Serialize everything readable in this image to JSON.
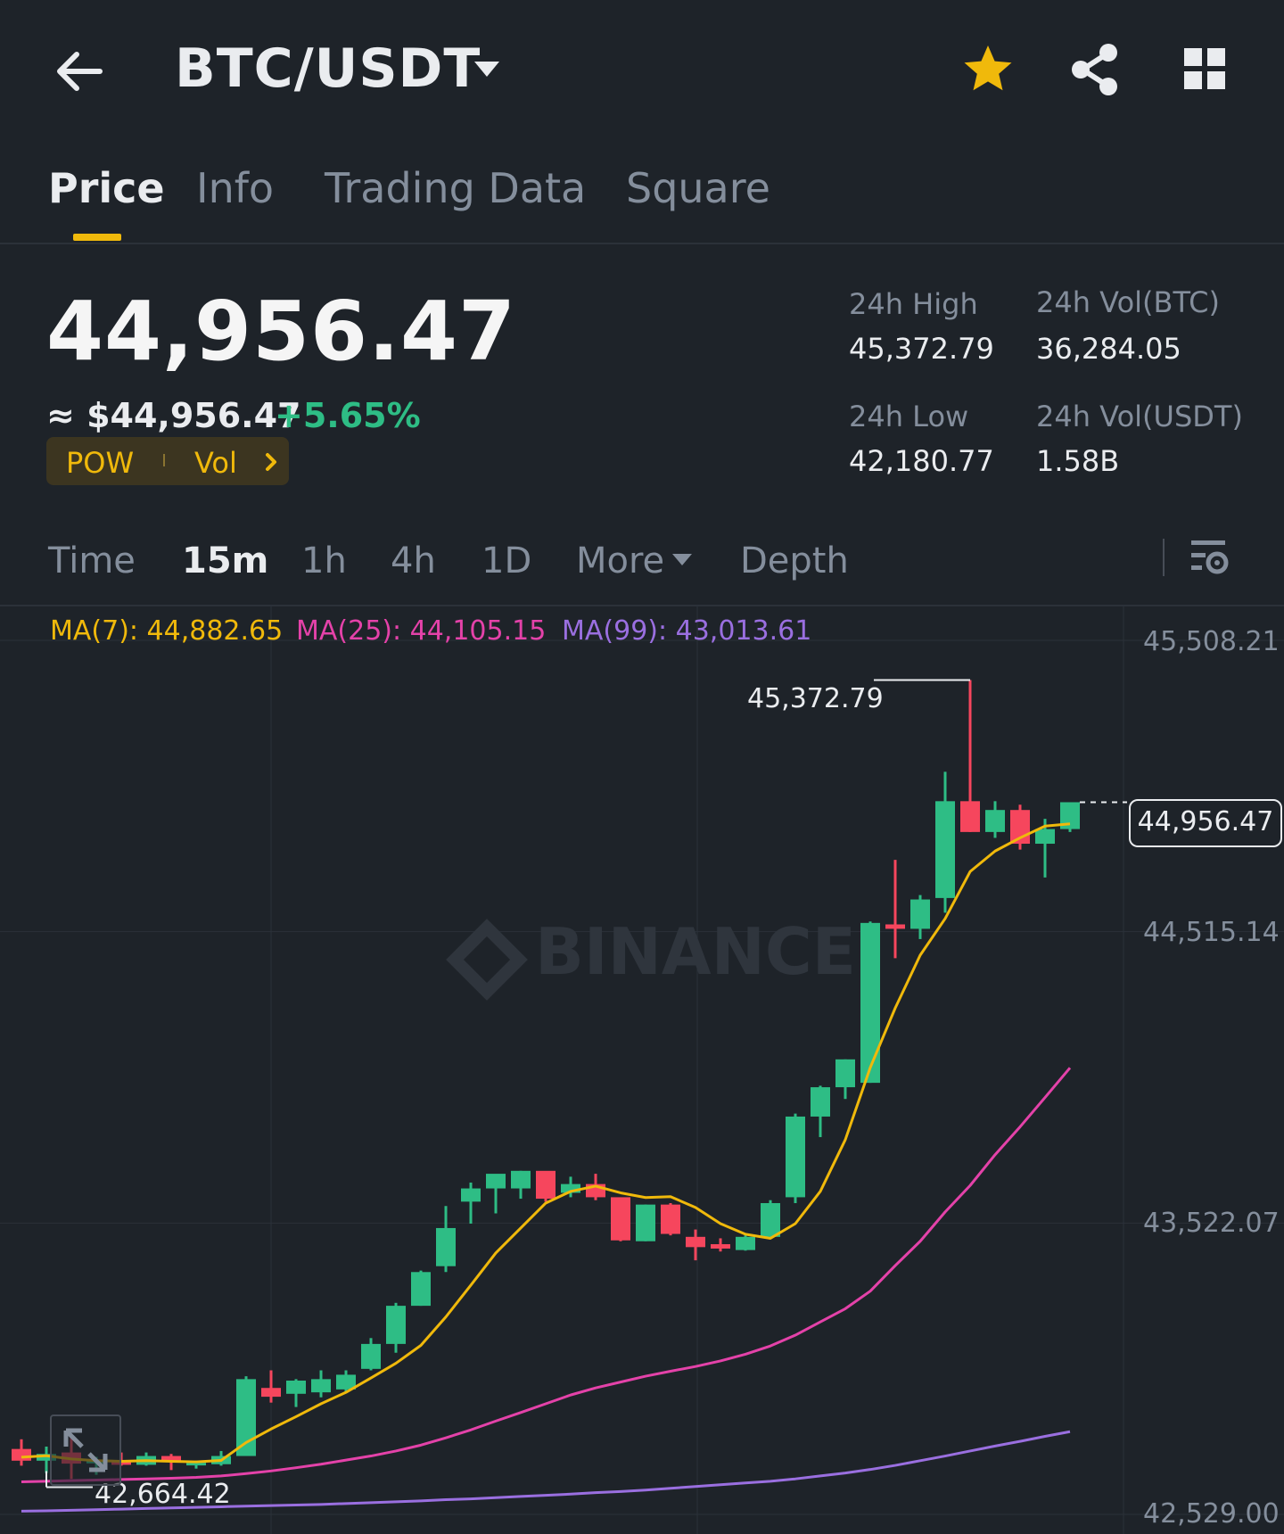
{
  "header": {
    "pair": "BTC/USDT"
  },
  "tabs": [
    {
      "label": "Price"
    },
    {
      "label": "Info"
    },
    {
      "label": "Trading Data"
    },
    {
      "label": "Square"
    }
  ],
  "ticker": {
    "last_price": "44,956.47",
    "fiat_price": "≈ $44,956.47",
    "change_pct": "+5.65%",
    "tag_pow": "POW",
    "tag_vol": "Vol",
    "stats": {
      "high_label": "24h High",
      "high_value": "45,372.79",
      "low_label": "24h Low",
      "low_value": "42,180.77",
      "vol_btc_label": "24h Vol(BTC)",
      "vol_btc_value": "36,284.05",
      "vol_usdt_label": "24h Vol(USDT)",
      "vol_usdt_value": "1.58B"
    }
  },
  "timeframes": [
    {
      "label": "Time"
    },
    {
      "label": "15m"
    },
    {
      "label": "1h"
    },
    {
      "label": "4h"
    },
    {
      "label": "1D"
    },
    {
      "label": "More"
    },
    {
      "label": "Depth"
    }
  ],
  "indicators": {
    "ma7": "MA(7): 44,882.65",
    "ma25": "MA(25): 44,105.15",
    "ma99": "MA(99): 43,013.61"
  },
  "colors": {
    "up": "#2ebd85",
    "down": "#f6465d",
    "accent": "#f0b90b",
    "ma7": "#f0b90b",
    "ma25": "#e442a9",
    "ma99": "#9a6fe0"
  },
  "chart_data": {
    "type": "candlestick",
    "symbol": "BTC/USDT",
    "interval": "15m",
    "y_ticks": [
      "45,508.21",
      "44,515.14",
      "43,522.07",
      "42,529.00"
    ],
    "ylim": [
      42529.0,
      45508.21
    ],
    "last_price_label": "44,956.47",
    "high_marker_label": "45,372.79",
    "low_marker_label": "42,664.42",
    "watermark": "BINANCE",
    "candles": [
      {
        "o": 42752,
        "h": 42785,
        "l": 42695,
        "c": 42712
      },
      {
        "o": 42712,
        "h": 42760,
        "l": 42670,
        "c": 42735
      },
      {
        "o": 42740,
        "h": 42790,
        "l": 42650,
        "c": 42702
      },
      {
        "o": 42705,
        "h": 42725,
        "l": 42664,
        "c": 42712
      },
      {
        "o": 42712,
        "h": 42740,
        "l": 42695,
        "c": 42698
      },
      {
        "o": 42698,
        "h": 42740,
        "l": 42695,
        "c": 42728
      },
      {
        "o": 42728,
        "h": 42735,
        "l": 42680,
        "c": 42708
      },
      {
        "o": 42700,
        "h": 42712,
        "l": 42685,
        "c": 42705
      },
      {
        "o": 42700,
        "h": 42745,
        "l": 42695,
        "c": 42728
      },
      {
        "o": 42728,
        "h": 43000,
        "l": 42728,
        "c": 42990
      },
      {
        "o": 42960,
        "h": 43020,
        "l": 42910,
        "c": 42930
      },
      {
        "o": 42940,
        "h": 42990,
        "l": 42895,
        "c": 42985
      },
      {
        "o": 42945,
        "h": 43020,
        "l": 42928,
        "c": 42990
      },
      {
        "o": 42955,
        "h": 43020,
        "l": 42945,
        "c": 43005
      },
      {
        "o": 43025,
        "h": 43130,
        "l": 43020,
        "c": 43110
      },
      {
        "o": 43110,
        "h": 43250,
        "l": 43080,
        "c": 43240
      },
      {
        "o": 43240,
        "h": 43360,
        "l": 43240,
        "c": 43355
      },
      {
        "o": 43375,
        "h": 43580,
        "l": 43355,
        "c": 43505
      },
      {
        "o": 43595,
        "h": 43660,
        "l": 43520,
        "c": 43640
      },
      {
        "o": 43640,
        "h": 43670,
        "l": 43555,
        "c": 43690
      },
      {
        "o": 43640,
        "h": 43700,
        "l": 43605,
        "c": 43700
      },
      {
        "o": 43700,
        "h": 43690,
        "l": 43595,
        "c": 43605
      },
      {
        "o": 43625,
        "h": 43680,
        "l": 43610,
        "c": 43655
      },
      {
        "o": 43655,
        "h": 43690,
        "l": 43600,
        "c": 43610
      },
      {
        "o": 43610,
        "h": 43600,
        "l": 43460,
        "c": 43463
      },
      {
        "o": 43460,
        "h": 43585,
        "l": 43460,
        "c": 43585
      },
      {
        "o": 43585,
        "h": 43590,
        "l": 43480,
        "c": 43485
      },
      {
        "o": 43475,
        "h": 43500,
        "l": 43395,
        "c": 43440
      },
      {
        "o": 43450,
        "h": 43470,
        "l": 43425,
        "c": 43435
      },
      {
        "o": 43430,
        "h": 43480,
        "l": 43428,
        "c": 43475
      },
      {
        "o": 43475,
        "h": 43600,
        "l": 43470,
        "c": 43590
      },
      {
        "o": 43610,
        "h": 43895,
        "l": 43590,
        "c": 43885
      },
      {
        "o": 43885,
        "h": 43990,
        "l": 43815,
        "c": 43985
      },
      {
        "o": 43985,
        "h": 44080,
        "l": 43945,
        "c": 44080
      },
      {
        "o": 44000,
        "h": 44550,
        "l": 44000,
        "c": 44545
      },
      {
        "o": 44540,
        "h": 44760,
        "l": 44425,
        "c": 44525
      },
      {
        "o": 44525,
        "h": 44640,
        "l": 44490,
        "c": 44625
      },
      {
        "o": 44630,
        "h": 45060,
        "l": 44580,
        "c": 44960
      },
      {
        "o": 44960,
        "h": 45372.79,
        "l": 44855,
        "c": 44855
      },
      {
        "o": 44855,
        "h": 44960,
        "l": 44835,
        "c": 44930
      },
      {
        "o": 44930,
        "h": 44948,
        "l": 44795,
        "c": 44815
      },
      {
        "o": 44815,
        "h": 44900,
        "l": 44700,
        "c": 44865
      },
      {
        "o": 44865,
        "h": 44956.47,
        "l": 44855,
        "c": 44956.47
      }
    ],
    "ma7": [
      42724,
      42729,
      42718,
      42712,
      42710,
      42712,
      42710,
      42708,
      42713,
      42774,
      42820,
      42862,
      42906,
      42945,
      42994,
      43044,
      43105,
      43202,
      43310,
      43420,
      43505,
      43590,
      43630,
      43648,
      43625,
      43609,
      43612,
      43575,
      43520,
      43484,
      43470,
      43520,
      43630,
      43806,
      44052,
      44255,
      44435,
      44560,
      44720,
      44790,
      44835,
      44875,
      44882.65
    ],
    "ma25": [
      42640,
      42642,
      42644,
      42646,
      42648,
      42650,
      42652,
      42655,
      42660,
      42668,
      42677,
      42688,
      42700,
      42714,
      42728,
      42745,
      42765,
      42790,
      42817,
      42847,
      42876,
      42906,
      42936,
      42960,
      42980,
      43000,
      43017,
      43033,
      43052,
      43075,
      43103,
      43140,
      43185,
      43230,
      43290,
      43377,
      43460,
      43560,
      43650,
      43755,
      43850,
      43950,
      44051
    ],
    "ma99": [
      42540,
      42541,
      42543,
      42545,
      42547,
      42549,
      42551,
      42553,
      42555,
      42557,
      42559,
      42561,
      42563,
      42566,
      42569,
      42572,
      42575,
      42579,
      42582,
      42586,
      42590,
      42594,
      42598,
      42603,
      42607,
      42612,
      42618,
      42624,
      42630,
      42636,
      42642,
      42650,
      42660,
      42670,
      42682,
      42696,
      42712,
      42728,
      42745,
      42762,
      42778,
      42795,
      42811
    ]
  }
}
